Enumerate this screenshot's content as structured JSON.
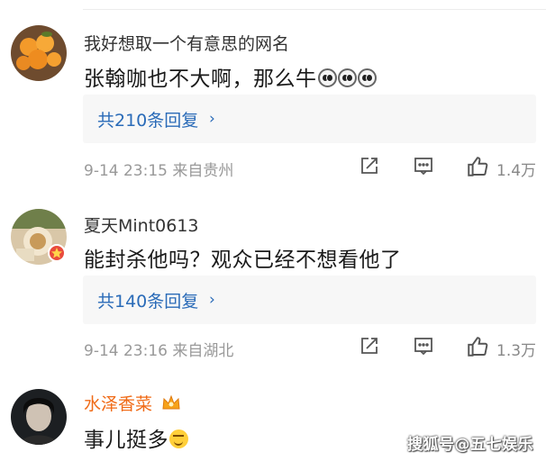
{
  "comments": [
    {
      "username": "我好想取一个有意思的网名",
      "text": "张翰咖也不大啊，那么牛",
      "emojis": [
        "shock-emoji",
        "shock-emoji",
        "shock-emoji"
      ],
      "replies_label": "共210条回复",
      "meta": "9-14 23:15  来自贵州",
      "likes": "1.4万"
    },
    {
      "username": "夏天Mint0613",
      "text": "能封杀他吗？观众已经不想看他了",
      "replies_label": "共140条回复",
      "meta": "9-14 23:16  来自湖北",
      "likes": "1.3万"
    },
    {
      "username": "水泽香菜",
      "text": "事儿挺多",
      "emojis": [
        "smirk-emoji"
      ]
    }
  ],
  "chevron": "›",
  "watermark": "搜狐号@五七娱乐",
  "colors": {
    "link": "#2a6bb8",
    "vip_name": "#f06a16",
    "meta": "#999999"
  }
}
